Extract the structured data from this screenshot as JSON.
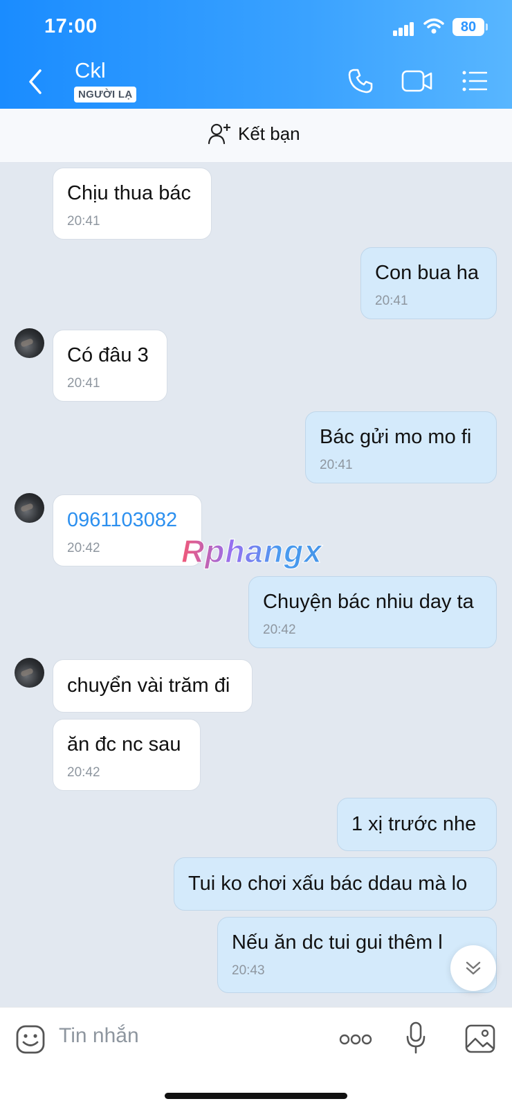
{
  "status_bar": {
    "time": "17:00",
    "battery": "80"
  },
  "header": {
    "contact_name": "Ckl",
    "badge": "NGƯỜI LẠ",
    "icons": [
      "back-arrow",
      "phone-icon",
      "video-camera-icon",
      "menu-list-icon"
    ]
  },
  "friend_bar": {
    "label": "Kết bạn"
  },
  "messages": [
    {
      "dir": "in",
      "text": "Chịu thua bác",
      "time": "20:41"
    },
    {
      "dir": "out",
      "text": "Con bua ha",
      "time": "20:41"
    },
    {
      "dir": "in",
      "text": "Có đâu 3",
      "time": "20:41"
    },
    {
      "dir": "out",
      "text": "Bác gửi mo mo fi",
      "time": "20:41"
    },
    {
      "dir": "in",
      "text": "0961103082",
      "time": "20:42",
      "is_link": true
    },
    {
      "dir": "out",
      "text": "Chuyện bác nhiu day ta",
      "time": "20:42"
    },
    {
      "dir": "in",
      "text": "chuyển vài trăm đi"
    },
    {
      "dir": "in",
      "text": "ăn đc nc sau",
      "time": "20:42"
    },
    {
      "dir": "out",
      "text": "1 xị trước nhe"
    },
    {
      "dir": "out",
      "text": "Tui ko chơi xấu bác ddau mà lo"
    },
    {
      "dir": "out",
      "text": "Nếu ăn dc tui gui thêm l",
      "time": "20:43"
    }
  ],
  "watermark": "Rphangx",
  "input": {
    "placeholder": "Tin nhắn"
  },
  "colors": {
    "header": "#2b95ff",
    "incoming": "#ffffff",
    "outgoing": "#d4eafb",
    "link": "#2b8fef",
    "background": "#e2e8f0"
  }
}
